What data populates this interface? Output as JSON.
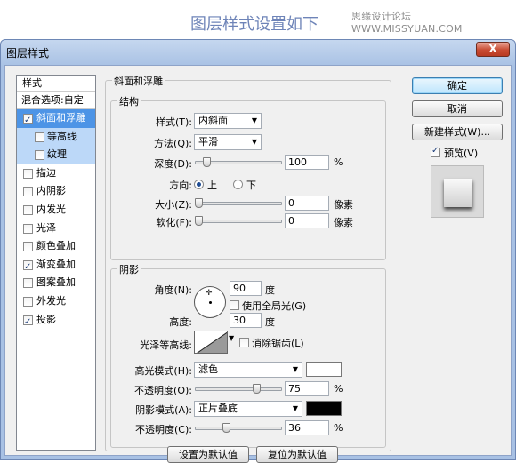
{
  "banner": {
    "title": "图层样式设置如下",
    "watermark": "思缘设计论坛 WWW.MISSYUAN.COM"
  },
  "window": {
    "title": "图层样式",
    "close_label": "X"
  },
  "styles_panel": {
    "header": "样式",
    "blend_options": "混合选项:自定",
    "items": [
      {
        "label": "斜面和浮雕",
        "checked": true,
        "selected": true
      },
      {
        "label": "等高线",
        "checked": false,
        "sub": true
      },
      {
        "label": "纹理",
        "checked": false,
        "sub": true
      },
      {
        "label": "描边",
        "checked": false
      },
      {
        "label": "内阴影",
        "checked": false
      },
      {
        "label": "内发光",
        "checked": false
      },
      {
        "label": "光泽",
        "checked": false
      },
      {
        "label": "颜色叠加",
        "checked": false
      },
      {
        "label": "渐变叠加",
        "checked": true
      },
      {
        "label": "图案叠加",
        "checked": false
      },
      {
        "label": "外发光",
        "checked": false
      },
      {
        "label": "投影",
        "checked": true
      }
    ]
  },
  "bevel": {
    "section_title": "斜面和浮雕",
    "structure_title": "结构",
    "style_label": "样式(T):",
    "style_value": "内斜面",
    "technique_label": "方法(Q):",
    "technique_value": "平滑",
    "depth_label": "深度(D):",
    "depth_value": "100",
    "depth_unit": "%",
    "depth_fraction": 0.1,
    "direction_label": "方向:",
    "direction_up": "上",
    "direction_down": "下",
    "direction_selected": "上",
    "size_label": "大小(Z):",
    "size_value": "0",
    "size_unit": "像素",
    "size_fraction": 0,
    "soften_label": "软化(F):",
    "soften_value": "0",
    "soften_unit": "像素",
    "soften_fraction": 0
  },
  "shading": {
    "title": "阴影",
    "angle_label": "角度(N):",
    "angle_value": "90",
    "angle_unit": "度",
    "global_light_label": "使用全局光(G)",
    "global_light_checked": false,
    "altitude_label": "高度:",
    "altitude_value": "30",
    "altitude_unit": "度",
    "gloss_contour_label": "光泽等高线:",
    "anti_alias_label": "消除锯齿(L)",
    "anti_alias_checked": false,
    "highlight_mode_label": "高光模式(H):",
    "highlight_mode_value": "滤色",
    "highlight_color": "#ffffff",
    "highlight_opacity_label": "不透明度(O):",
    "highlight_opacity_value": "75",
    "highlight_opacity_unit": "%",
    "highlight_opacity_fraction": 0.75,
    "shadow_mode_label": "阴影模式(A):",
    "shadow_mode_value": "正片叠底",
    "shadow_color": "#000000",
    "shadow_opacity_label": "不透明度(C):",
    "shadow_opacity_value": "36",
    "shadow_opacity_unit": "%",
    "shadow_opacity_fraction": 0.36
  },
  "footer": {
    "make_default": "设置为默认值",
    "reset_default": "复位为默认值"
  },
  "right_panel": {
    "ok": "确定",
    "cancel": "取消",
    "new_style": "新建样式(W)...",
    "preview_label": "预览(V)",
    "preview_checked": true
  }
}
